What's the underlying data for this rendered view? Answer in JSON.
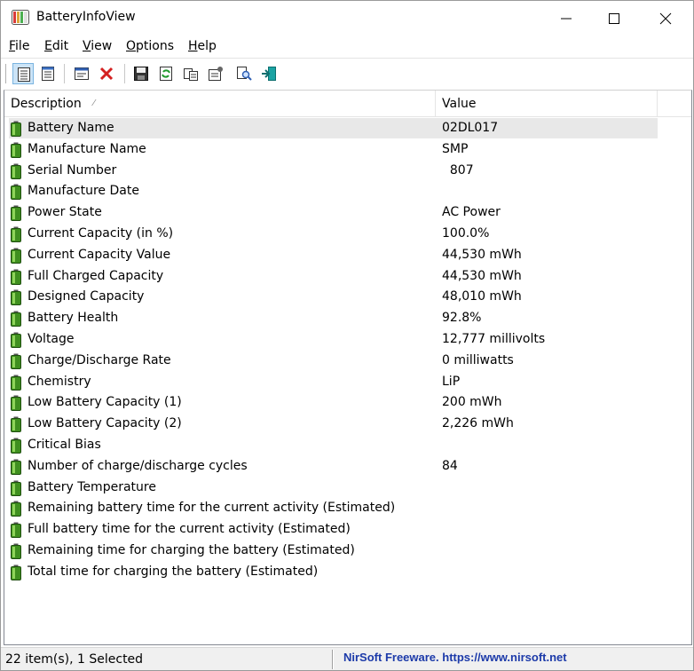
{
  "window": {
    "title": "BatteryInfoView"
  },
  "menu": [
    "File",
    "Edit",
    "View",
    "Options",
    "Help"
  ],
  "toolbar": [
    {
      "icon": "details-view-icon",
      "pressed": true
    },
    {
      "icon": "list-view-icon",
      "pressed": false
    },
    {
      "icon": "properties-window-icon",
      "pressed": false
    },
    {
      "icon": "close-red-x-icon",
      "pressed": false
    },
    {
      "icon": "save-disk-icon",
      "pressed": false
    },
    {
      "icon": "refresh-icon",
      "pressed": false
    },
    {
      "icon": "copy-icon",
      "pressed": false
    },
    {
      "icon": "properties-icon",
      "pressed": false
    },
    {
      "icon": "find-icon",
      "pressed": false
    },
    {
      "icon": "exit-icon",
      "pressed": false
    }
  ],
  "columns": {
    "description": "Description",
    "value": "Value"
  },
  "rows": [
    {
      "description": "Battery Name",
      "value": "02DL017"
    },
    {
      "description": "Manufacture Name",
      "value": "SMP"
    },
    {
      "description": "Serial Number",
      "value": "  807"
    },
    {
      "description": "Manufacture Date",
      "value": ""
    },
    {
      "description": "Power State",
      "value": "AC Power"
    },
    {
      "description": "Current Capacity (in %)",
      "value": "100.0%"
    },
    {
      "description": "Current Capacity Value",
      "value": "44,530 mWh"
    },
    {
      "description": "Full Charged Capacity",
      "value": "44,530 mWh"
    },
    {
      "description": "Designed Capacity",
      "value": "48,010 mWh"
    },
    {
      "description": "Battery Health",
      "value": "92.8%"
    },
    {
      "description": "Voltage",
      "value": "12,777 millivolts"
    },
    {
      "description": "Charge/Discharge Rate",
      "value": "0 milliwatts"
    },
    {
      "description": "Chemistry",
      "value": "LiP"
    },
    {
      "description": "Low Battery Capacity (1)",
      "value": "200 mWh"
    },
    {
      "description": "Low Battery Capacity (2)",
      "value": "2,226 mWh"
    },
    {
      "description": "Critical Bias",
      "value": ""
    },
    {
      "description": "Number of charge/discharge cycles",
      "value": "84"
    },
    {
      "description": "Battery Temperature",
      "value": ""
    },
    {
      "description": "Remaining battery time for the current activity (Estimated)",
      "value": ""
    },
    {
      "description": "Full battery time for the current activity (Estimated)",
      "value": ""
    },
    {
      "description": "Remaining time for charging the battery (Estimated)",
      "value": ""
    },
    {
      "description": "Total  time for charging the battery (Estimated)",
      "value": ""
    }
  ],
  "selected_index": 0,
  "status": {
    "items": "22 item(s), 1 Selected",
    "link": "NirSoft Freeware. https://www.nirsoft.net"
  }
}
